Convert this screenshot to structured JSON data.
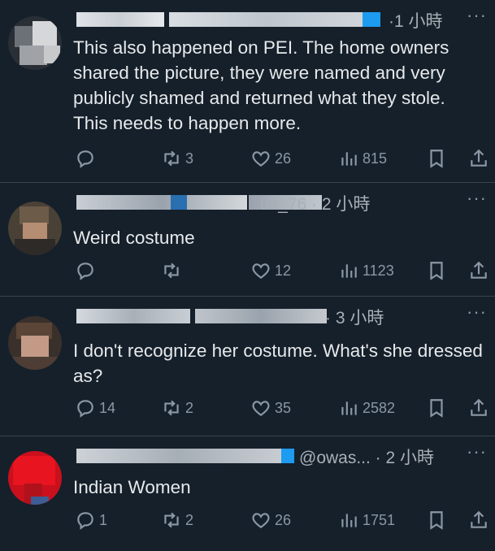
{
  "replies": [
    {
      "time": "·1 小時",
      "text": "This also happened on PEI. The home owners shared the picture, they were named and very publicly shamed and returned what they stole. This needs to happen more.",
      "replies": "",
      "retweets": "3",
      "likes": "26",
      "views": "815"
    },
    {
      "time": "ufi_76 · 2 小時",
      "text": "Weird costume",
      "replies": "",
      "retweets": "",
      "likes": "12",
      "views": "1123"
    },
    {
      "time": "· 3 小時",
      "text": "I don't recognize her costume. What's she dressed as?",
      "replies": "14",
      "retweets": "2",
      "likes": "35",
      "views": "2582"
    },
    {
      "time": "@owas... · 2 小時",
      "text": "Indian Women",
      "replies": "1",
      "retweets": "2",
      "likes": "26",
      "views": "1751"
    }
  ],
  "more_label": "···",
  "icons": [
    "reply-icon",
    "retweet-icon",
    "like-icon",
    "views-icon",
    "bookmark-icon",
    "share-icon"
  ],
  "colors": {
    "background": "#15202b",
    "text": "#e7e9ea",
    "muted": "#8b98a5",
    "verified": "#1d9bf0"
  }
}
